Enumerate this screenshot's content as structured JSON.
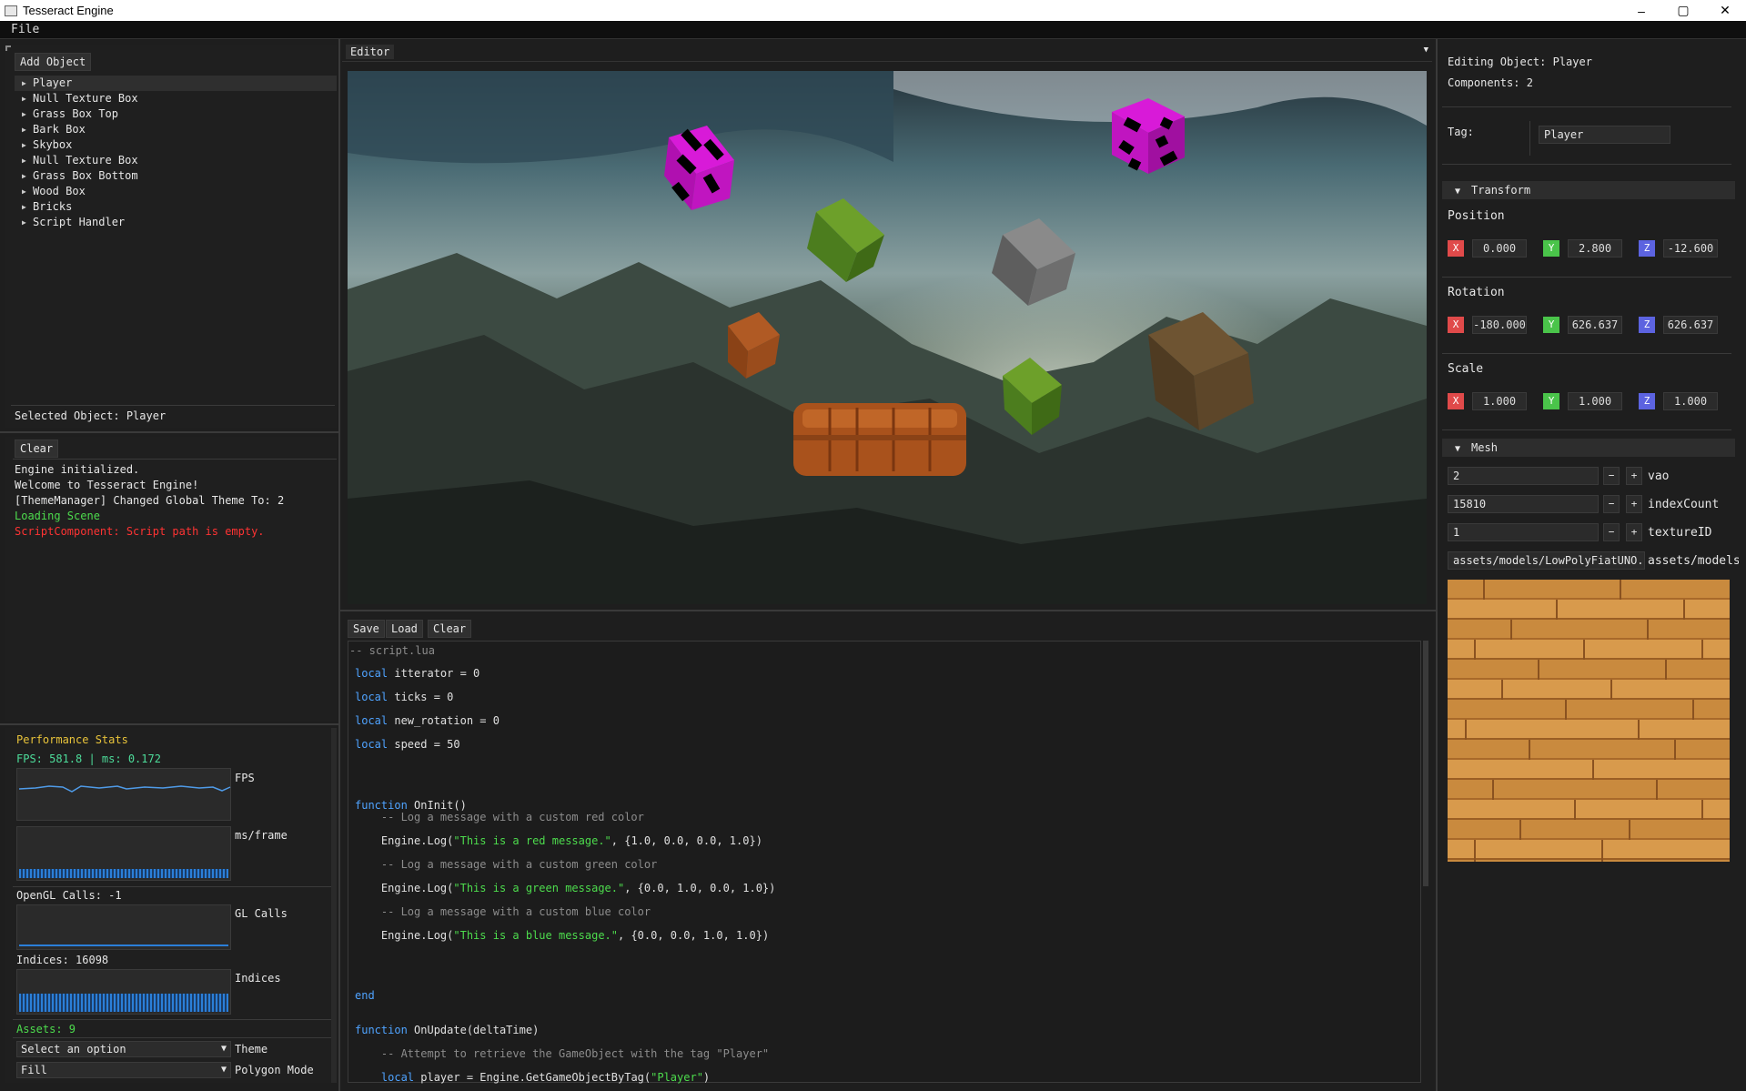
{
  "window": {
    "title": "Tesseract Engine",
    "controls": [
      "–",
      "▢",
      "✕"
    ]
  },
  "menu": [
    "File"
  ],
  "hierarchy": {
    "add_button": "Add Object",
    "items": [
      "Player",
      "Null Texture Box",
      "Grass Box Top",
      "Bark Box",
      "Skybox",
      "Null Texture Box",
      "Grass Box Bottom",
      "Wood Box",
      "Bricks",
      "Script Handler"
    ],
    "selected_label": "Selected Object: Player"
  },
  "console": {
    "clear_button": "Clear",
    "lines": [
      {
        "text": "Engine initialized.",
        "color": "#e6e6e6"
      },
      {
        "text": "Welcome to Tesseract Engine!",
        "color": "#e6e6e6"
      },
      {
        "text": "[ThemeManager] Changed Global Theme To: 2",
        "color": "#e6e6e6"
      },
      {
        "text": "Loading Scene",
        "color": "#4ddc4d"
      },
      {
        "text": "ScriptComponent: Script path is empty.",
        "color": "#ff3333"
      }
    ]
  },
  "perf": {
    "title": "Performance Stats",
    "fps_line": "FPS: 581.8 | ms: 0.172",
    "fps_label": "FPS",
    "ms_label": "ms/frame",
    "gl_calls_line": "OpenGL Calls: -1",
    "gl_label": "GL Calls",
    "indices_line": "Indices: 16098",
    "indices_label": "Indices",
    "assets_line": "Assets: 9",
    "theme_value": "Select an option",
    "theme_label": "Theme",
    "polygon_value": "Fill",
    "polygon_label": "Polygon Mode"
  },
  "editor": {
    "tab": "Editor",
    "menu_icon": "▼"
  },
  "script": {
    "save": "Save",
    "load": "Load",
    "clear": "Clear",
    "filename": "-- script.lua",
    "lines": [
      {
        "kw": "local",
        "rest": " itterator = 0"
      },
      {
        "kw": "local",
        "rest": " ticks = 0"
      },
      {
        "kw": "local",
        "rest": " new_rotation = 0"
      },
      {
        "kw": "local",
        "rest": " speed = 50"
      },
      {
        "kw": "function",
        "rest": " OnInit()"
      },
      {
        "cm": "    -- Log a message with a custom red color"
      },
      {
        "pre": "    Engine.Log(",
        "str": "\"This is a red message.\"",
        "post": ", {1.0, 0.0, 0.0, 1.0})"
      },
      {
        "cm": "    -- Log a message with a custom green color"
      },
      {
        "pre": "    Engine.Log(",
        "str": "\"This is a green message.\"",
        "post": ", {0.0, 1.0, 0.0, 1.0})"
      },
      {
        "cm": "    -- Log a message with a custom blue color"
      },
      {
        "pre": "    Engine.Log(",
        "str": "\"This is a blue message.\"",
        "post": ", {0.0, 0.0, 1.0, 1.0})"
      },
      {
        "kw": "end",
        "rest": ""
      },
      {
        "kw": "function",
        "rest": " OnUpdate(deltaTime)"
      },
      {
        "cm": "    -- Attempt to retrieve the GameObject with the tag \"Player\""
      },
      {
        "kw": "    local",
        "rest": " player = Engine.GetGameObjectByTag(",
        "str": "\"Player\"",
        "post": ")"
      }
    ]
  },
  "inspector": {
    "editing": "Editing Object: Player",
    "components": "Components: 2",
    "tag_label": "Tag:",
    "tag_value": "Player",
    "transform_label": "Transform",
    "position_label": "Position",
    "position": [
      "0.000",
      "2.800",
      "-12.600"
    ],
    "rotation_label": "Rotation",
    "rotation": [
      "-180.000",
      "626.637",
      "626.637"
    ],
    "scale_label": "Scale",
    "scale": [
      "1.000",
      "1.000",
      "1.000"
    ],
    "axis": [
      "X",
      "Y",
      "Z"
    ],
    "axis_colors": [
      "#e04a4a",
      "#4ac44a",
      "#5c63e0"
    ],
    "mesh_label": "Mesh",
    "vao_value": "2",
    "vao_label": "vao",
    "index_value": "15810",
    "index_label": "indexCount",
    "tex_value": "1",
    "tex_label": "textureID",
    "path_value": "assets/models/LowPolyFiatUNO.o",
    "path_label": "assets/models/l",
    "minus": "−",
    "plus": "+"
  }
}
